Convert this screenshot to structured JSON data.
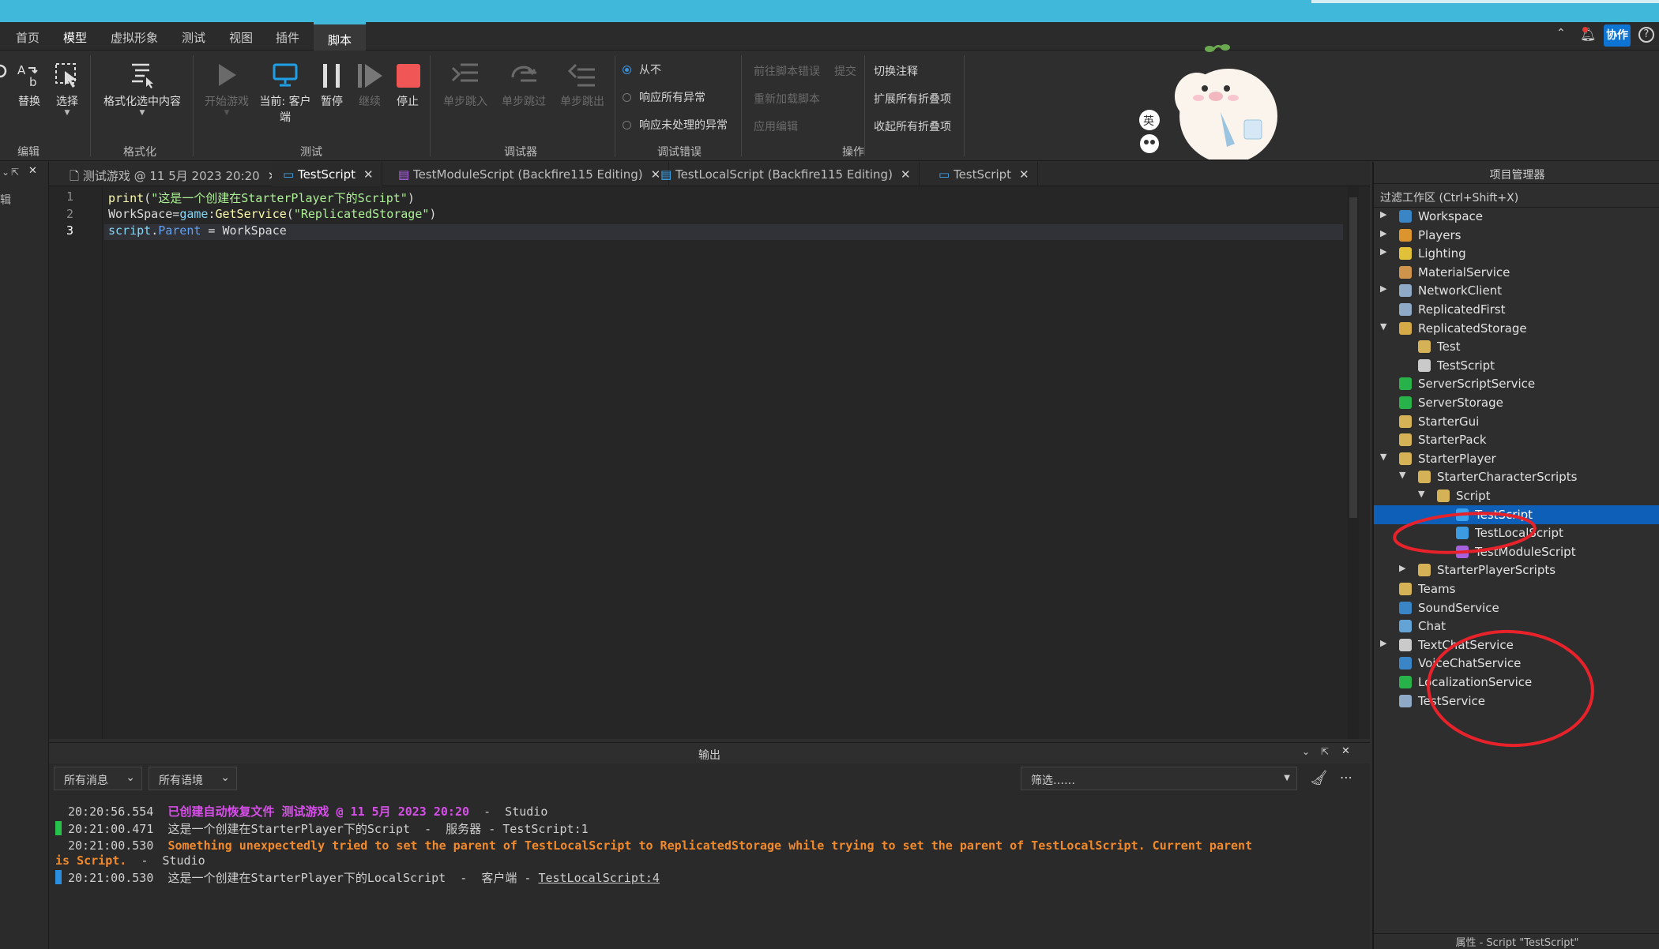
{
  "menubar": {
    "items": [
      "首页",
      "模型",
      "虚拟形象",
      "测试",
      "视图",
      "插件",
      "脚本"
    ],
    "active": "脚本",
    "collab_label": "协作"
  },
  "ribbon": {
    "edit_group": {
      "replace": "替换",
      "select": "选择",
      "label": "编辑"
    },
    "format_group": {
      "format": "格式化选中内容",
      "label": "格式化"
    },
    "test_group": {
      "start": "开始游戏",
      "current": "当前: 客户",
      "current2": "端",
      "pause": "暂停",
      "resume": "继续",
      "stop": "停止",
      "label": "测试"
    },
    "debugger_group": {
      "step_into": "单步跳入",
      "step_over": "单步跳过",
      "step_out": "单步跳出",
      "label": "调试器"
    },
    "debug_errors": {
      "never": "从不",
      "all": "响应所有异常",
      "unhandled": "响应未处理的异常",
      "label": "调试错误"
    },
    "actions": {
      "goto_error": "前往脚本错误",
      "commit": "提交",
      "reload": "重新加载脚本",
      "apply": "应用编辑",
      "toggle_comment": "切换注释",
      "expand_all": "扩展所有折叠项",
      "collapse_all": "收起所有折叠项",
      "label": "操作"
    },
    "mascot_badge": "英"
  },
  "left_strip": {
    "label": "辑"
  },
  "tabs": [
    {
      "label": "测试游戏 @ 11 5月 2023 20:20"
    },
    {
      "label": "TestScript"
    },
    {
      "label": "TestModuleScript (Backfire115 Editing)"
    },
    {
      "label": "TestLocalScript (Backfire115 Editing)"
    },
    {
      "label": "TestScript"
    }
  ],
  "editor": {
    "line_numbers": [
      "1",
      "2",
      "3"
    ],
    "line1": {
      "fn": "print",
      "open": "(",
      "str": "\"这是一个创建在StarterPlayer下的Script\"",
      "close": ")"
    },
    "line2": {
      "lhs": "WorkSpace=",
      "game": "game",
      "colon": ":",
      "fn": "GetService",
      "open": "(",
      "str": "\"ReplicatedStorage\"",
      "close": ")"
    },
    "line3": {
      "script": "script",
      "dot": ".",
      "prop": "Parent",
      "rest": " = WorkSpace"
    }
  },
  "output": {
    "title": "输出",
    "filter_messages": "所有消息",
    "filter_context": "所有语境",
    "search_placeholder": "筛选……",
    "lines": [
      {
        "time": "20:20:56.554",
        "msg": "已创建自动恢复文件 测试游戏 @ 11 5月 2023 20:20",
        "src": "  -  Studio"
      },
      {
        "time": "20:21:00.471",
        "msg": "这是一个创建在StarterPlayer下的Script",
        "src": "  -  服务器 - TestScript:1"
      },
      {
        "time": "20:21:00.530",
        "msg": "Something unexpectedly tried to set the parent of TestLocalScript to ReplicatedStorage while trying to set the parent of TestLocalScript. Current parent",
        "msg2": "is Script.",
        "src": "  -  Studio"
      },
      {
        "time": "20:21:00.530",
        "msg": "这是一个创建在StarterPlayer下的LocalScript",
        "src": "  -  客户端 - ",
        "link": "TestLocalScript:4"
      }
    ]
  },
  "explorer": {
    "title": "项目管理器",
    "filter": "过滤工作区 (Ctrl+Shift+X)",
    "nodes": [
      {
        "label": "Workspace",
        "arrow": "▶"
      },
      {
        "label": "Players",
        "arrow": "▶"
      },
      {
        "label": "Lighting",
        "arrow": "▶"
      },
      {
        "label": "MaterialService",
        "arrow": ""
      },
      {
        "label": "NetworkClient",
        "arrow": "▶"
      },
      {
        "label": "ReplicatedFirst",
        "arrow": ""
      },
      {
        "label": "ReplicatedStorage",
        "arrow": "▼"
      },
      {
        "label": "Test",
        "arrow": ""
      },
      {
        "label": "TestScript",
        "arrow": ""
      },
      {
        "label": "ServerScriptService",
        "arrow": ""
      },
      {
        "label": "ServerStorage",
        "arrow": ""
      },
      {
        "label": "StarterGui",
        "arrow": ""
      },
      {
        "label": "StarterPack",
        "arrow": ""
      },
      {
        "label": "StarterPlayer",
        "arrow": "▼"
      },
      {
        "label": "StarterCharacterScripts",
        "arrow": "▼"
      },
      {
        "label": "Script",
        "arrow": "▼"
      },
      {
        "label": "TestScript",
        "arrow": ""
      },
      {
        "label": "TestLocalScript",
        "arrow": ""
      },
      {
        "label": "TestModuleScript",
        "arrow": ""
      },
      {
        "label": "StarterPlayerScripts",
        "arrow": "▶"
      },
      {
        "label": "Teams",
        "arrow": ""
      },
      {
        "label": "SoundService",
        "arrow": ""
      },
      {
        "label": "Chat",
        "arrow": ""
      },
      {
        "label": "TextChatService",
        "arrow": "▶"
      },
      {
        "label": "VoiceChatService",
        "arrow": ""
      },
      {
        "label": "LocalizationService",
        "arrow": ""
      },
      {
        "label": "TestService",
        "arrow": ""
      }
    ],
    "properties_title": "属性 - Script \"TestScript\""
  },
  "colors": {
    "accent": "#3fb8d9",
    "selection": "#0e5fb8",
    "annotation": "#e8222a"
  }
}
